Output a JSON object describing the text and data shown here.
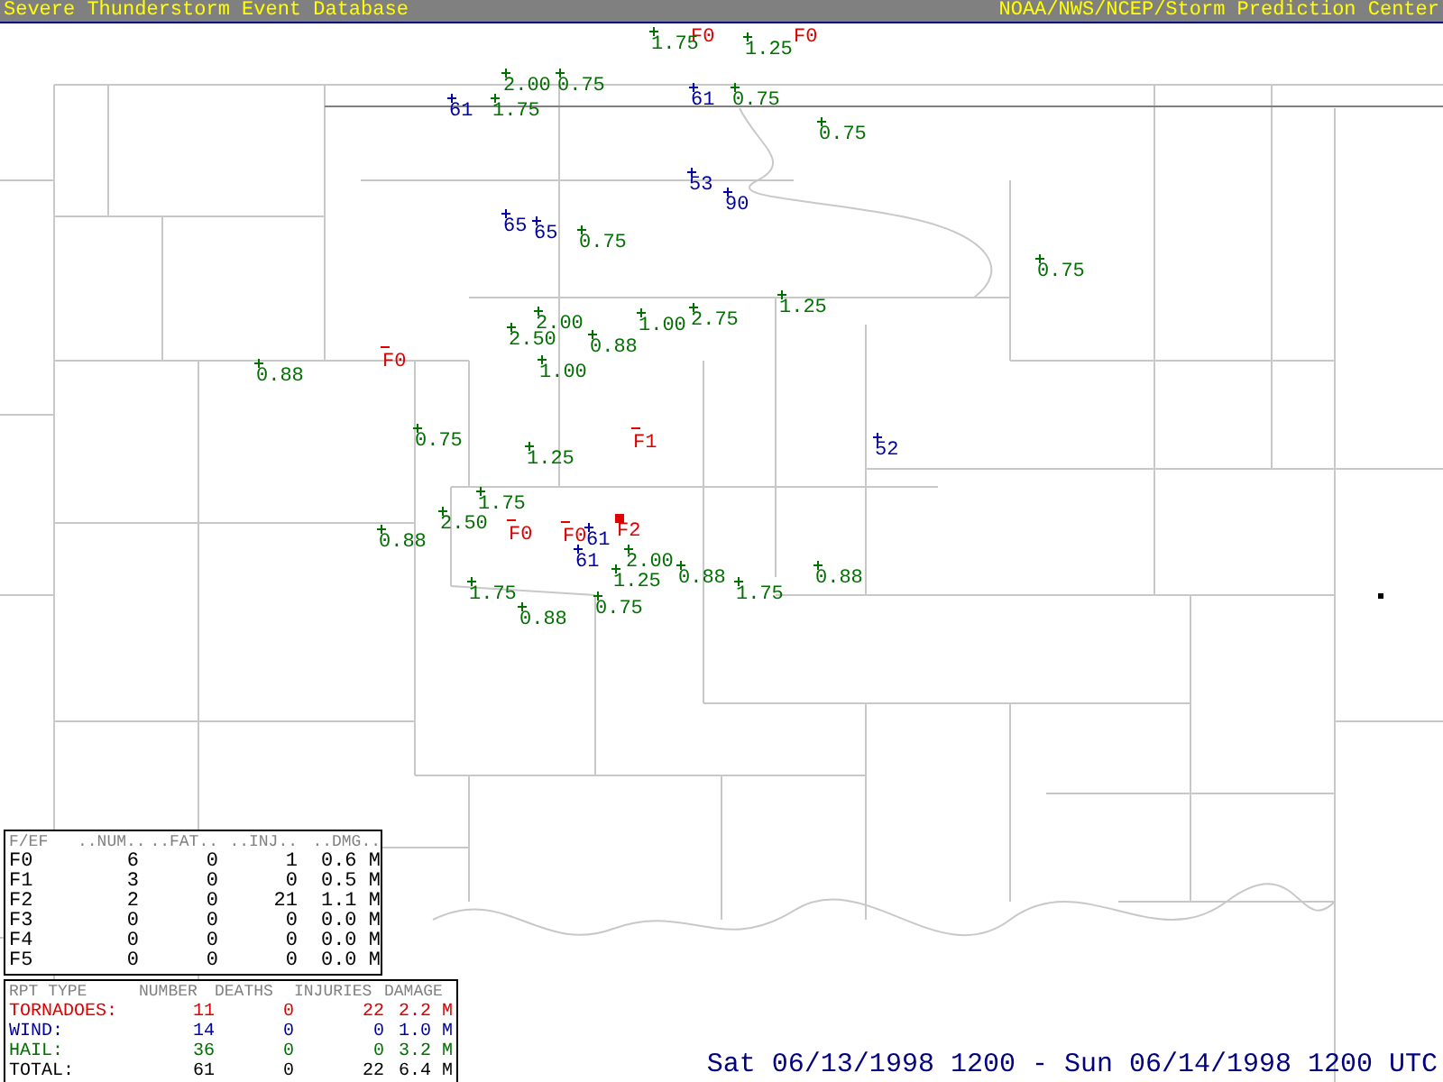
{
  "header": {
    "title": "Severe Thunderstorm Event Database",
    "source": "NOAA/NWS/NCEP/Storm Prediction Center"
  },
  "reports": [
    {
      "kind": "tornado",
      "label": "F0"
    },
    {
      "kind": "tornado",
      "label": "F0"
    },
    {
      "kind": "hail",
      "label": "1.75"
    },
    {
      "kind": "hail",
      "label": "1.25"
    },
    {
      "kind": "hail",
      "label": "2.00"
    },
    {
      "kind": "hail",
      "label": "0.75"
    },
    {
      "kind": "wind",
      "label": "61"
    },
    {
      "kind": "hail",
      "label": "1.75"
    },
    {
      "kind": "wind",
      "label": "61"
    },
    {
      "kind": "hail",
      "label": "0.75"
    },
    {
      "kind": "hail",
      "label": "0.75"
    },
    {
      "kind": "wind",
      "label": "53"
    },
    {
      "kind": "wind",
      "label": "90"
    },
    {
      "kind": "wind",
      "label": "65"
    },
    {
      "kind": "wind",
      "label": "65"
    },
    {
      "kind": "hail",
      "label": "0.75"
    },
    {
      "kind": "hail",
      "label": "0.75"
    },
    {
      "kind": "hail",
      "label": "1.25"
    },
    {
      "kind": "hail",
      "label": "2.00"
    },
    {
      "kind": "hail",
      "label": "2.50"
    },
    {
      "kind": "hail",
      "label": "1.00"
    },
    {
      "kind": "hail",
      "label": "0.88"
    },
    {
      "kind": "hail",
      "label": "1.00"
    },
    {
      "kind": "hail",
      "label": "2.75"
    },
    {
      "kind": "hail",
      "label": "0.88"
    },
    {
      "kind": "tornado",
      "label": "F0"
    },
    {
      "kind": "hail",
      "label": "0.75"
    },
    {
      "kind": "hail",
      "label": "1.25"
    },
    {
      "kind": "tornado",
      "label": "F1"
    },
    {
      "kind": "wind",
      "label": "52"
    },
    {
      "kind": "hail",
      "label": "1.75"
    },
    {
      "kind": "hail",
      "label": "2.50"
    },
    {
      "kind": "tornado",
      "label": "F0"
    },
    {
      "kind": "hail",
      "label": "0.88"
    },
    {
      "kind": "tornado",
      "label": "F0"
    },
    {
      "kind": "wind",
      "label": "61"
    },
    {
      "kind": "wind",
      "label": "61"
    },
    {
      "kind": "tornado",
      "label": "F2"
    },
    {
      "kind": "hail",
      "label": "2.00"
    },
    {
      "kind": "hail",
      "label": "1.25"
    },
    {
      "kind": "hail",
      "label": "0.88"
    },
    {
      "kind": "hail",
      "label": "1.75"
    },
    {
      "kind": "hail",
      "label": "0.88"
    },
    {
      "kind": "hail",
      "label": "1.75"
    },
    {
      "kind": "hail",
      "label": "0.88"
    },
    {
      "kind": "hail",
      "label": "0.75"
    }
  ],
  "fscale_table": {
    "columns": [
      "F/EF",
      "..NUM..",
      "..FAT..",
      "..INJ..",
      "..DMG.."
    ],
    "rows": [
      [
        "F0",
        "6",
        "0",
        "1",
        "0.6 M"
      ],
      [
        "F1",
        "3",
        "0",
        "0",
        "0.5 M"
      ],
      [
        "F2",
        "2",
        "0",
        "21",
        "1.1 M"
      ],
      [
        "F3",
        "0",
        "0",
        "0",
        "0.0 M"
      ],
      [
        "F4",
        "0",
        "0",
        "0",
        "0.0 M"
      ],
      [
        "F5",
        "0",
        "0",
        "0",
        "0.0 M"
      ]
    ]
  },
  "summary_table": {
    "columns": [
      "RPT TYPE",
      "NUMBER",
      "DEATHS",
      "INJURIES",
      "DAMAGE"
    ],
    "rows": [
      {
        "kind": "tornado",
        "cells": [
          "TORNADOES:",
          "11",
          "0",
          "22",
          "2.2 M"
        ]
      },
      {
        "kind": "wind",
        "cells": [
          "WIND:",
          "14",
          "0",
          "0",
          "1.0 M"
        ]
      },
      {
        "kind": "hail",
        "cells": [
          "HAIL:",
          "36",
          "0",
          "0",
          "3.2 M"
        ]
      },
      {
        "kind": "total",
        "cells": [
          "TOTAL:",
          "61",
          "0",
          "22",
          "6.4 M"
        ]
      }
    ]
  },
  "period": "Sat 06/13/1998 1200 - Sun 06/14/1998 1200 UTC"
}
